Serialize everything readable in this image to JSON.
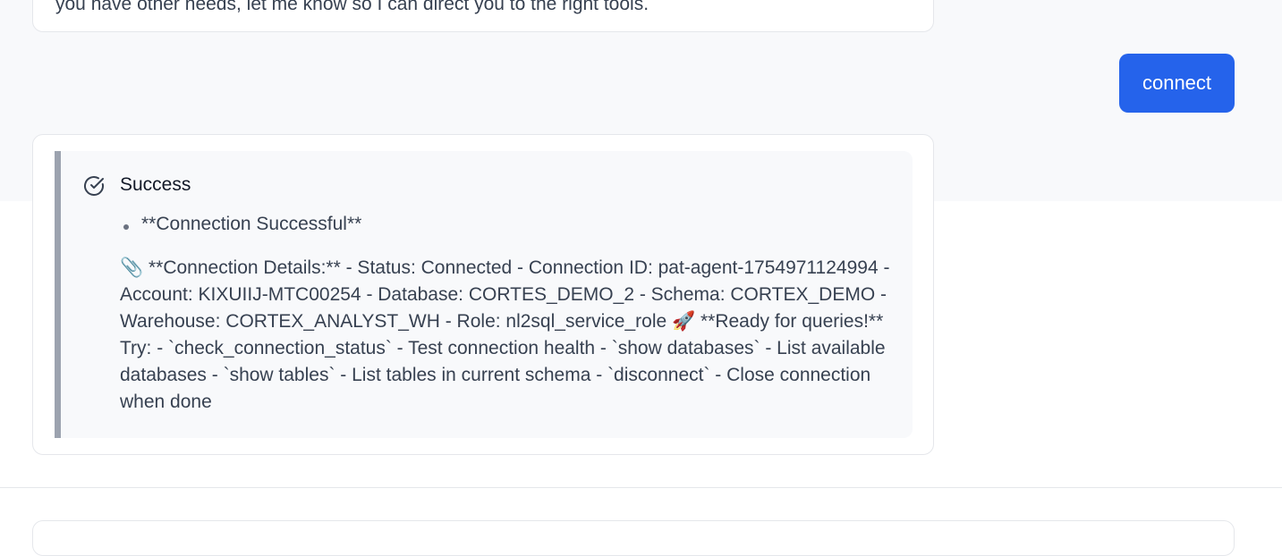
{
  "previous_message": {
    "text": "you have other needs, let me know so I can direct you to the right tools."
  },
  "user_message": {
    "text": "connect"
  },
  "assistant_reply": {
    "alert_icon": "check-circle-icon",
    "title": "Success",
    "bullet": "**Connection Successful**",
    "details": "📎 **Connection Details:** - Status: Connected - Connection ID: pat-agent-1754971124994 - Account: KIXUIIJ-MTC00254 - Database: CORTES_DEMO_2 - Schema: CORTEX_DEMO - Warehouse: CORTEX_ANALYST_WH - Role: nl2sql_service_role 🚀 **Ready for queries!** Try: - `check_connection_status` - Test connection health - `show databases` - List available databases - `show tables` - List tables in current schema - `disconnect` - Close connection when done"
  },
  "colors": {
    "accent": "#2563eb",
    "alert_border": "#9ca3af",
    "background": "#f8f9fb"
  }
}
